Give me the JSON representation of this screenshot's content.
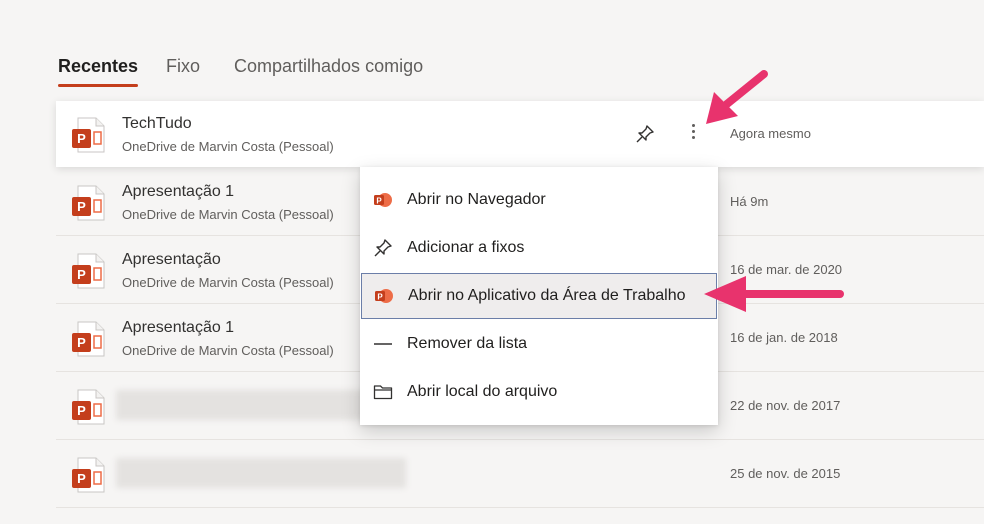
{
  "tabs": [
    {
      "label": "Recentes",
      "active": true
    },
    {
      "label": "Fixo",
      "active": false
    },
    {
      "label": "Compartilhados comigo",
      "active": false
    }
  ],
  "files": [
    {
      "title": "TechTudo",
      "location": "OneDrive de Marvin Costa (Pessoal)",
      "date": "Agora mesmo",
      "selected": true
    },
    {
      "title": "Apresentação 1",
      "location": "OneDrive de Marvin Costa (Pessoal)",
      "date": "Há 9m"
    },
    {
      "title": "Apresentação",
      "location": "OneDrive de Marvin Costa (Pessoal)",
      "date": "16 de mar. de 2020"
    },
    {
      "title": "Apresentação 1",
      "location": "OneDrive de Marvin Costa (Pessoal)",
      "date": "16 de jan. de 2018"
    },
    {
      "title": "",
      "location": "",
      "date": "22 de nov. de 2017",
      "blurred": true
    },
    {
      "title": "",
      "location": "",
      "date": "25 de nov. de 2015",
      "blurred": true
    }
  ],
  "context_menu": {
    "items": [
      {
        "label": "Abrir no Navegador",
        "icon": "powerpoint-icon"
      },
      {
        "label": "Adicionar a fixos",
        "icon": "pin-icon"
      },
      {
        "label": "Abrir no Aplicativo da Área de Trabalho",
        "icon": "powerpoint-icon",
        "highlighted": true
      },
      {
        "label": "Remover da lista",
        "icon": "remove-icon"
      },
      {
        "label": "Abrir local do arquivo",
        "icon": "folder-icon"
      }
    ]
  },
  "colors": {
    "accent": "#c43e1c",
    "annotation_arrow": "#e8336d",
    "highlight_border": "#6b7ea8"
  }
}
